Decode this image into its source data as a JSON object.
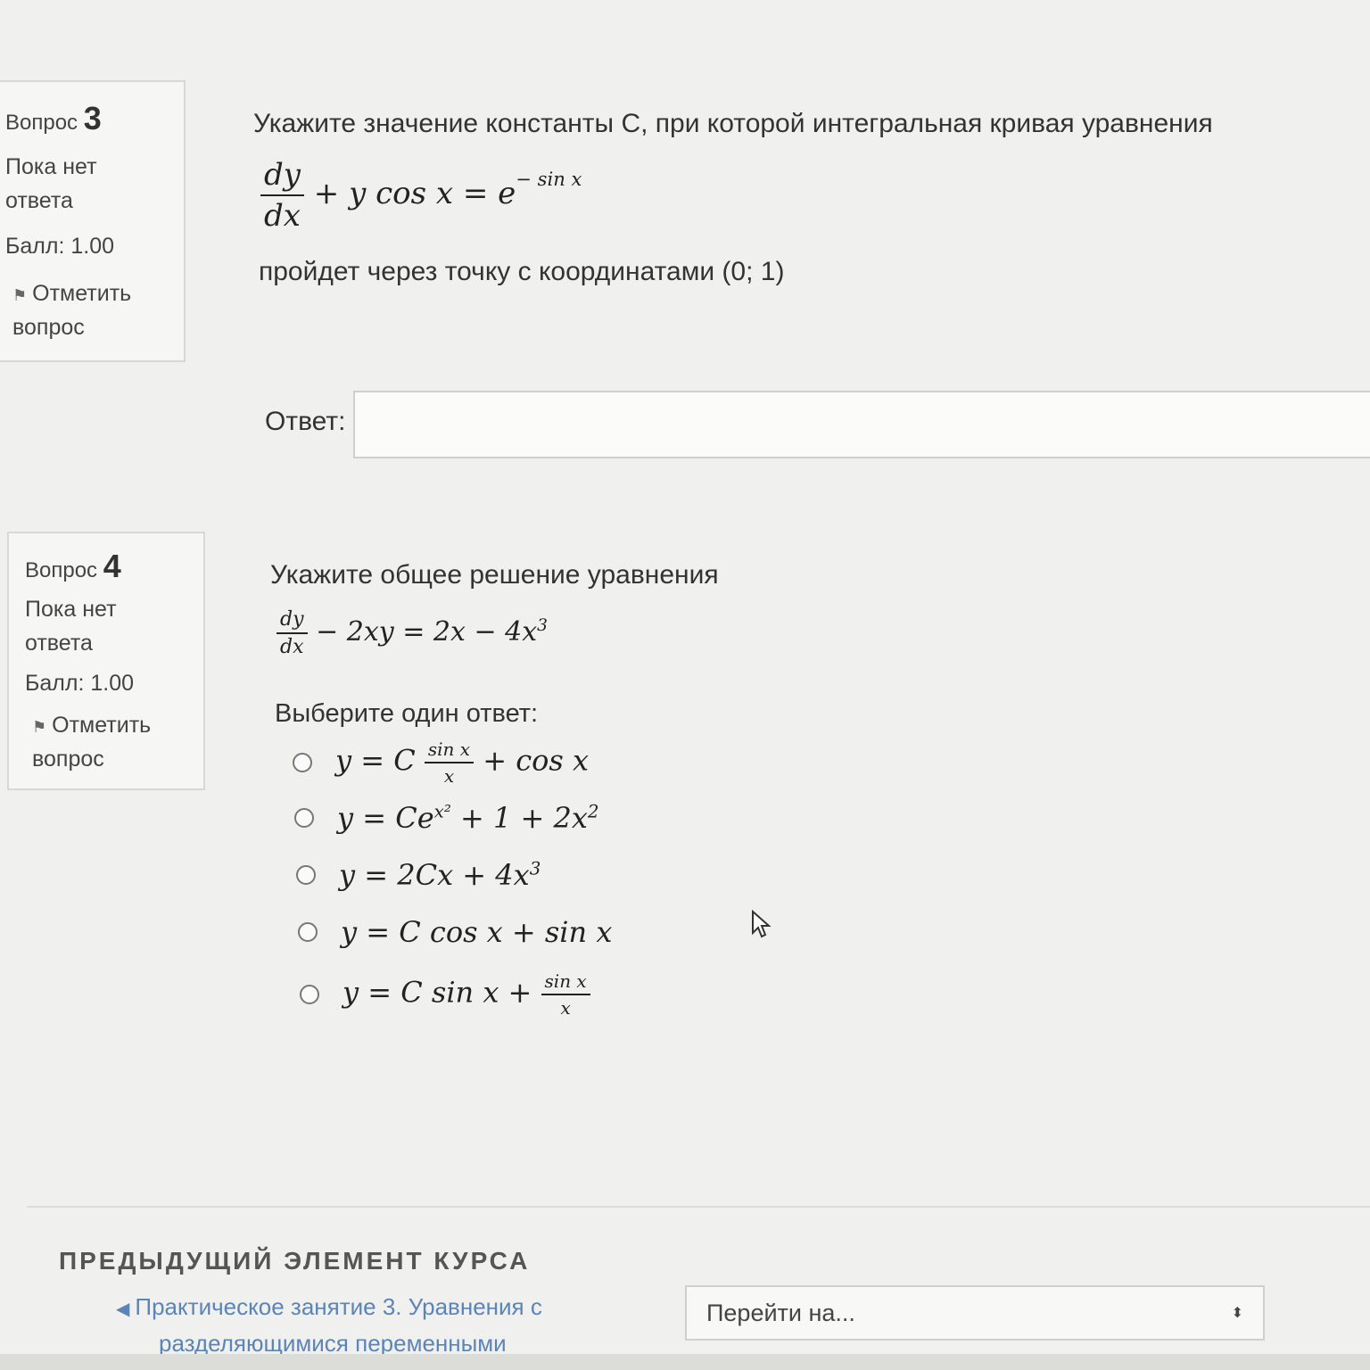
{
  "q3": {
    "label": "Вопрос",
    "number": "3",
    "state_line1": "Пока нет",
    "state_line2": "ответа",
    "grade": "Балл: 1.00",
    "flag_line1": "Отметить",
    "flag_line2": "вопрос",
    "text1": "Укажите значение константы C, при которой интегральная кривая уравнения",
    "eq_num": "dy",
    "eq_den": "dx",
    "eq_rest": "+ y cos x = e",
    "eq_sup": "− sin x",
    "text2": "пройдет через точку с координатами (0; 1)",
    "answer_label": "Ответ:",
    "answer_value": ""
  },
  "q4": {
    "label": "Вопрос",
    "number": "4",
    "state_line1": "Пока нет",
    "state_line2": "ответа",
    "grade": "Балл: 1.00",
    "flag_line1": "Отметить",
    "flag_line2": "вопрос",
    "text1": "Укажите общее решение уравнения",
    "eq_num": "dy",
    "eq_den": "dx",
    "eq_rest": "− 2xy = 2x − 4x",
    "eq_sup": "3",
    "choose_label": "Выберите один ответ:",
    "options": {
      "o1": {
        "a": "y = C",
        "fnum": "sin x",
        "fden": "x",
        "b": "+ cos x"
      },
      "o2": {
        "a": "y = Ce",
        "sup": "x²",
        "b": "+ 1 + 2x",
        "sup2": "2"
      },
      "o3": {
        "a": "y = 2Cx + 4x",
        "sup": "3"
      },
      "o4": {
        "a": "y = C cos x + sin x"
      },
      "o5": {
        "a": "y = C sin x +",
        "fnum": "sin x",
        "fden": "x"
      }
    }
  },
  "footer": {
    "prev_heading": "ПРЕДЫДУЩИЙ ЭЛЕМЕНТ КУРСА",
    "prev_link_line1": "Практическое занятие 3. Уравнения с",
    "prev_link_line2": "разделяющимися переменными",
    "jump_placeholder": "Перейти на..."
  }
}
